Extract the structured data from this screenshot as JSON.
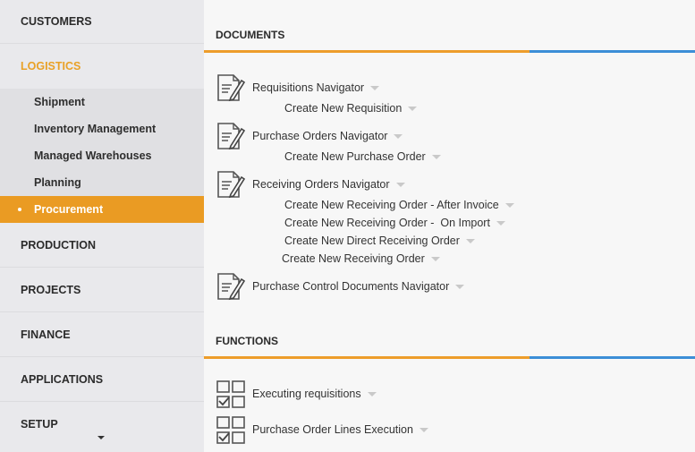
{
  "sidebar": {
    "customers": "CUSTOMERS",
    "logistics": "LOGISTICS",
    "logistics_items": [
      "Shipment",
      "Inventory Management",
      "Managed Warehouses",
      "Planning",
      "Procurement"
    ],
    "production": "PRODUCTION",
    "projects": "PROJECTS",
    "finance": "FINANCE",
    "applications": "APPLICATIONS",
    "setup": "SETUP"
  },
  "documents": {
    "title": "DOCUMENTS",
    "requisitions_nav": "Requisitions Navigator",
    "create_requisition": "Create New Requisition",
    "po_nav": "Purchase Orders Navigator",
    "create_po": "Create New Purchase Order",
    "ro_nav": "Receiving Orders Navigator",
    "create_ro_after_invoice": "Create New Receiving Order - After Invoice",
    "create_ro_on_import": "Create New Receiving Order -  On Import",
    "create_direct_ro": "Create New Direct Receiving Order",
    "create_ro": "Create New Receiving Order",
    "pcd_nav": "Purchase Control Documents Navigator"
  },
  "functions": {
    "title": "FUNCTIONS",
    "executing_requisitions": "Executing requisitions",
    "po_lines_execution": "Purchase Order Lines Execution"
  },
  "colors": {
    "accent_orange": "#ea9b23",
    "accent_blue": "#3c8ed7",
    "sidebar_bg": "#e9e9ec"
  }
}
